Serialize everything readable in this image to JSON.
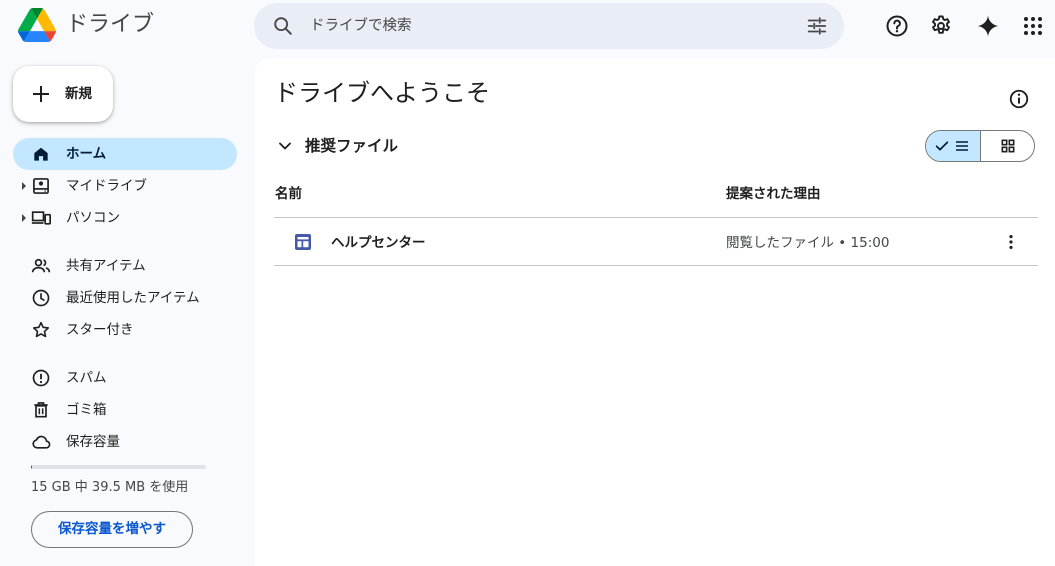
{
  "header": {
    "app_title": "ドライブ",
    "search_placeholder": "ドライブで検索"
  },
  "sidebar": {
    "new_label": "新規",
    "items": [
      {
        "label": "ホーム",
        "icon": "home-icon",
        "active": true
      },
      {
        "label": "マイドライブ",
        "icon": "my-drive-icon"
      },
      {
        "label": "パソコン",
        "icon": "computers-icon"
      },
      {
        "label": "共有アイテム",
        "icon": "shared-icon"
      },
      {
        "label": "最近使用したアイテム",
        "icon": "clock-icon"
      },
      {
        "label": "スター付き",
        "icon": "star-icon"
      },
      {
        "label": "スパム",
        "icon": "spam-icon"
      },
      {
        "label": "ゴミ箱",
        "icon": "trash-icon"
      },
      {
        "label": "保存容量",
        "icon": "cloud-icon"
      }
    ],
    "storage_text": "15 GB 中 39.5 MB を使用",
    "storage_fraction": 0.0026,
    "more_storage_label": "保存容量を増やす"
  },
  "main": {
    "welcome": "ドライブへようこそ",
    "section_title": "推奨ファイル",
    "columns": {
      "name": "名前",
      "reason": "提案された理由"
    },
    "rows": [
      {
        "name": "ヘルプセンター",
        "reason": "閲覧したファイル • 15:00",
        "icon": "site-icon"
      }
    ]
  },
  "colors": {
    "accent": "#0b57d0",
    "active_bg": "#c2e7ff",
    "background": "#f8fafd",
    "search_bg": "#e9eef6",
    "file_icon": "#4559a9"
  }
}
